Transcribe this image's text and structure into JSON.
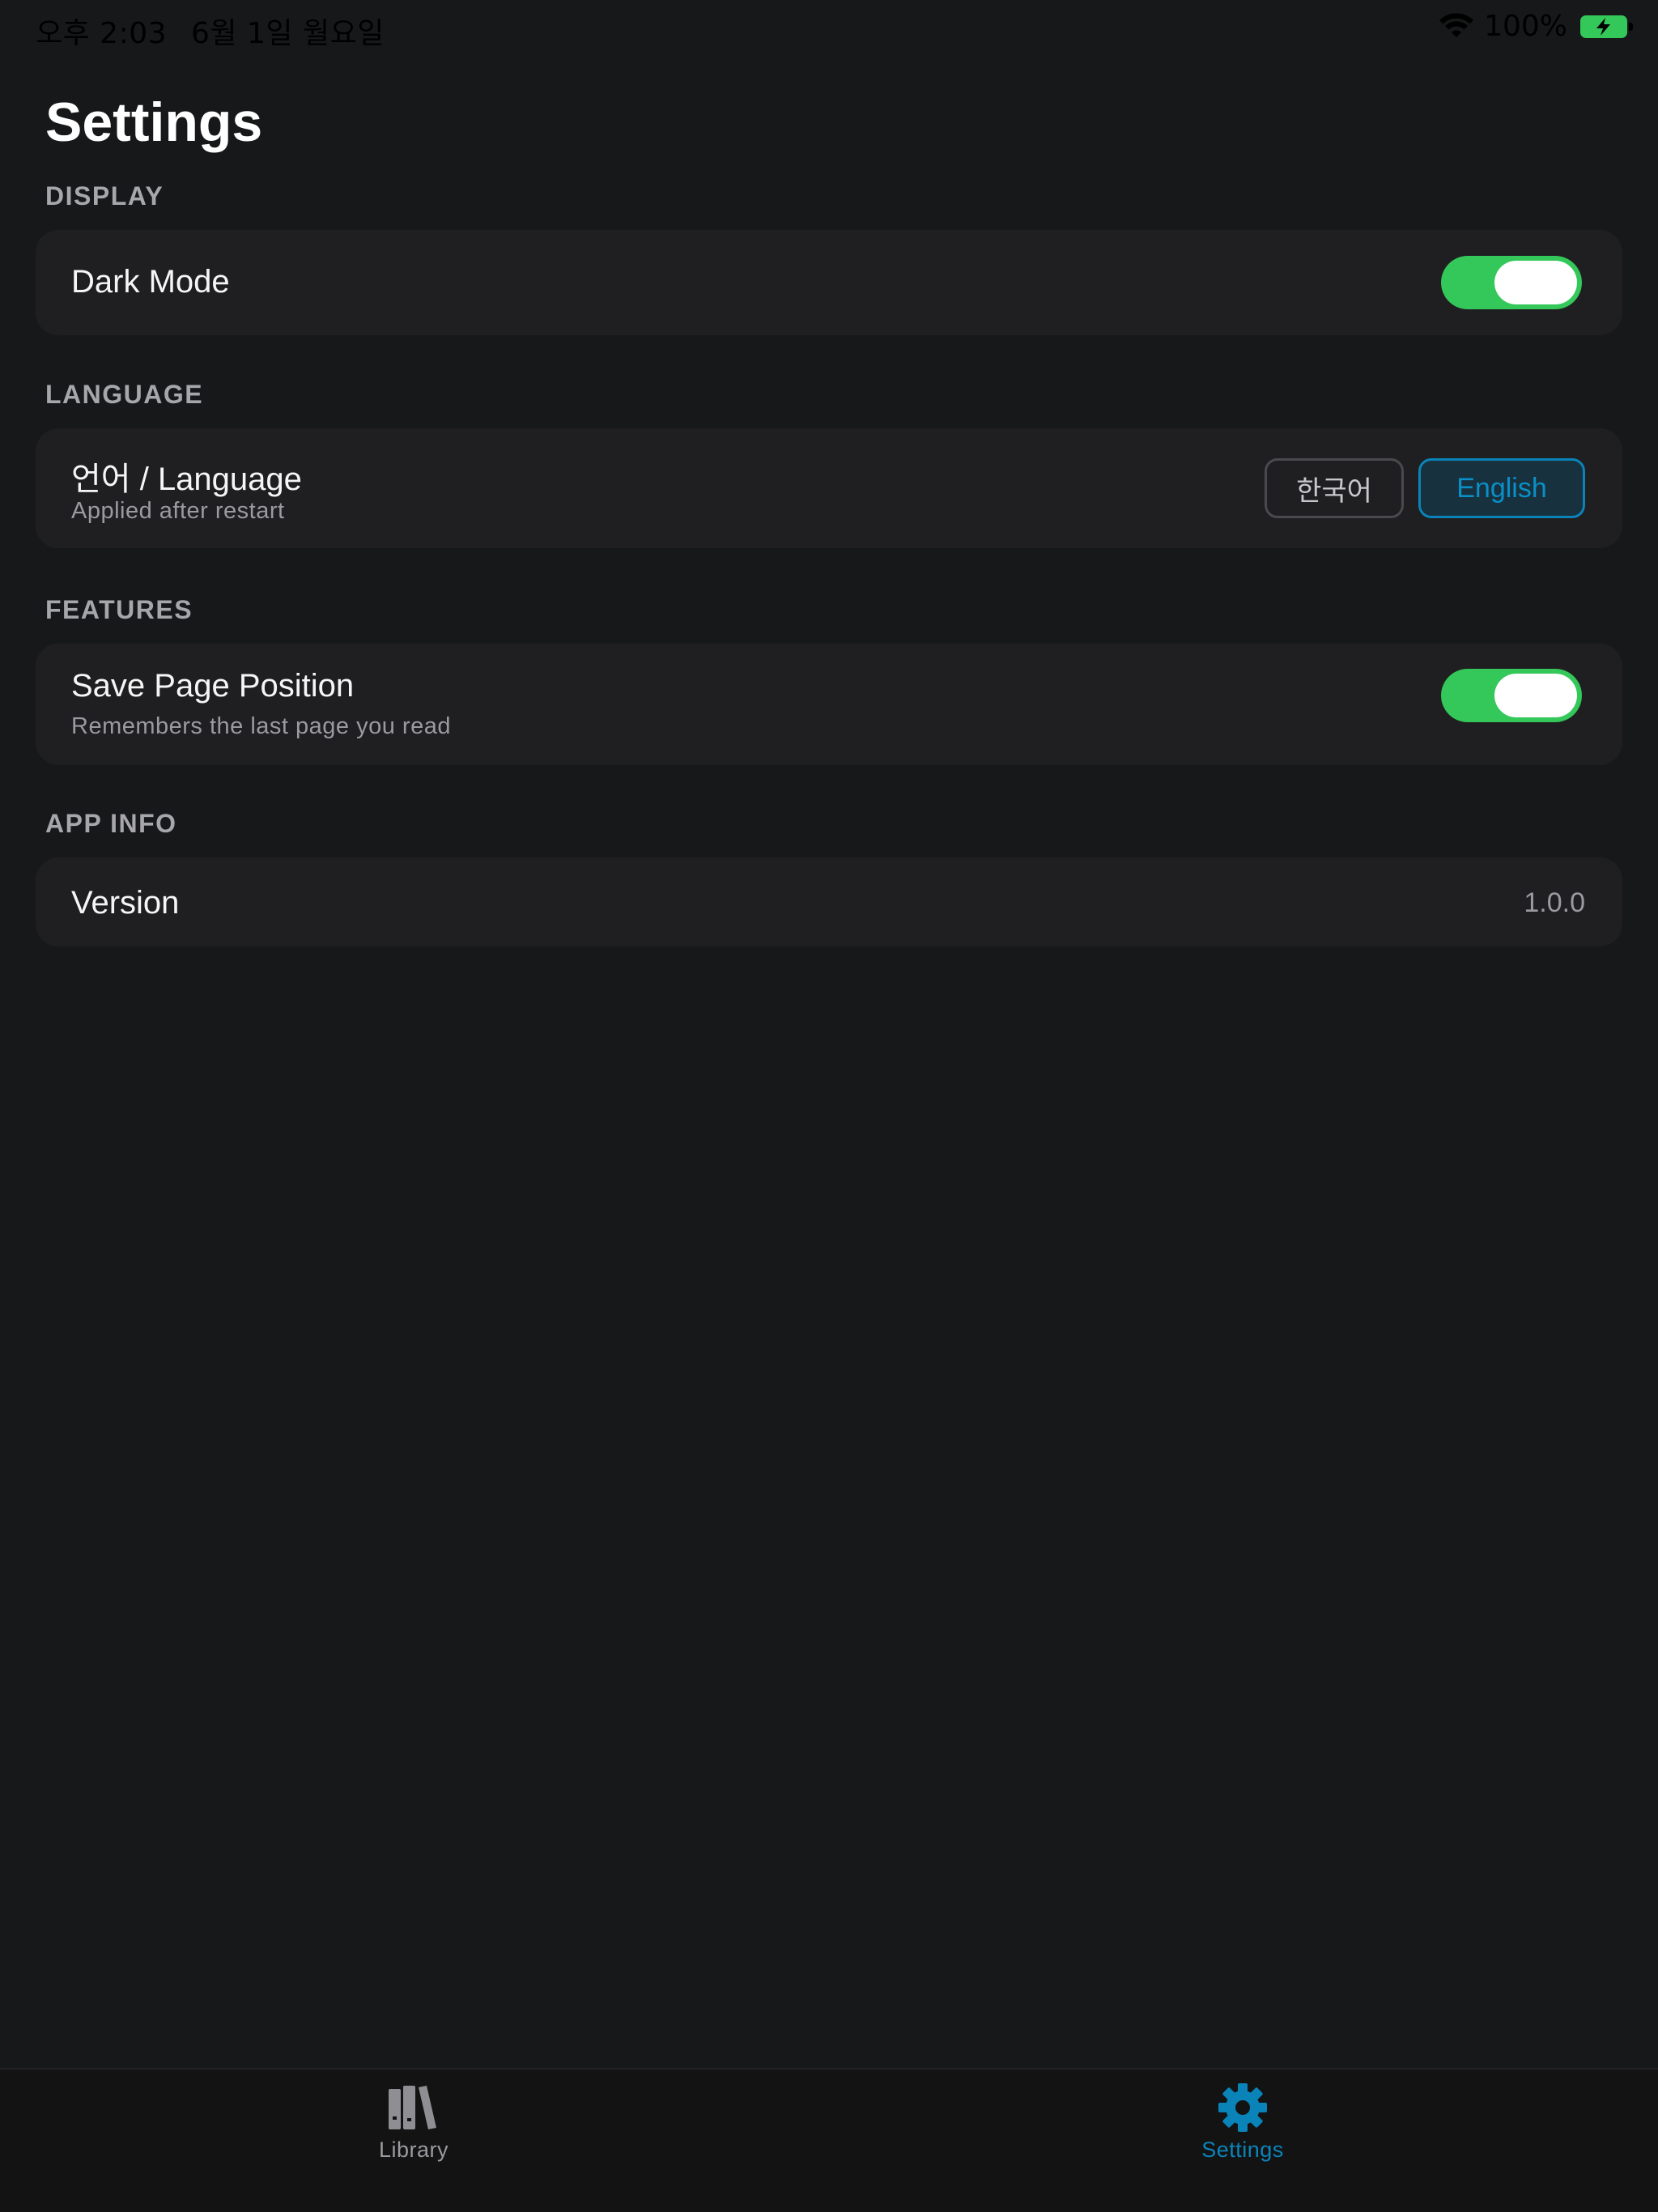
{
  "status_bar": {
    "time": "오후 2:03",
    "date": "6월 1일 월요일",
    "battery_percent": "100%",
    "wifi_icon": "wifi-icon",
    "battery_icon": "battery-charging-icon"
  },
  "page_title": "Settings",
  "sections": {
    "display": {
      "header": "DISPLAY",
      "dark_mode": {
        "label": "Dark Mode",
        "enabled": true
      }
    },
    "language": {
      "header": "LANGUAGE",
      "title": "언어 / Language",
      "subtitle": "Applied after restart",
      "options": [
        "한국어",
        "English"
      ],
      "selected": "English"
    },
    "features": {
      "header": "FEATURES",
      "save_page_position": {
        "label": "Save Page Position",
        "subtitle": "Remembers the last page you read",
        "enabled": true
      }
    },
    "app_info": {
      "header": "APP INFO",
      "version_label": "Version",
      "version_value": "1.0.0"
    }
  },
  "tab_bar": {
    "tabs": [
      {
        "label": "Library",
        "icon": "library-books-icon",
        "active": false
      },
      {
        "label": "Settings",
        "icon": "gear-icon",
        "active": true
      }
    ]
  },
  "colors": {
    "background": "#17181a",
    "card": "#1f1f21",
    "toggle_on": "#34c759",
    "accent": "#0a84b8",
    "secondary_text": "#9a9aa0"
  }
}
